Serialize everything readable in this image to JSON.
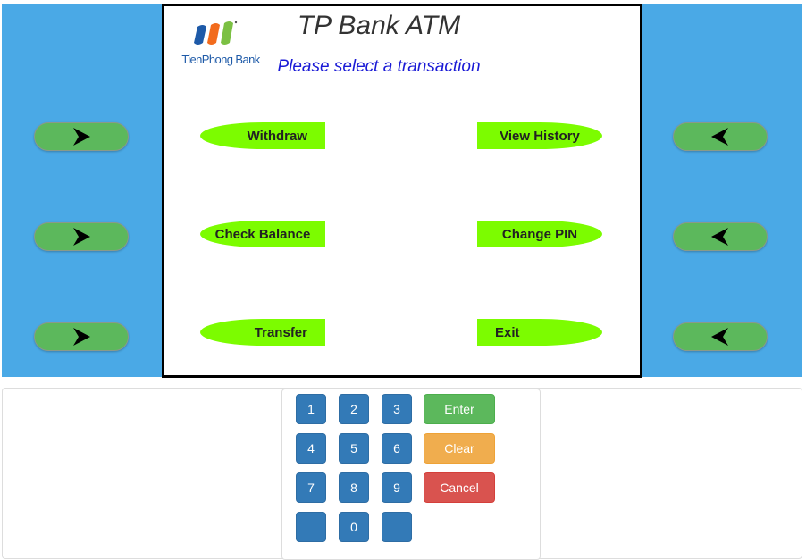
{
  "screen": {
    "title": "TP Bank ATM",
    "prompt": "Please select a transaction",
    "logo_text": "TienPhong Bank",
    "logo_colors": {
      "blue": "#1e5aa8",
      "orange": "#f26b1d",
      "green": "#7bc043"
    }
  },
  "options": {
    "left": [
      "Withdraw",
      "Check Balance",
      "Transfer"
    ],
    "right": [
      "View History",
      "Change PIN",
      "Exit"
    ]
  },
  "side_buttons": {
    "left_icon": "arrow-right-icon",
    "right_icon": "arrow-left-icon"
  },
  "keypad": {
    "keys": [
      "1",
      "2",
      "3",
      "4",
      "5",
      "6",
      "7",
      "8",
      "9",
      "",
      "0",
      ""
    ],
    "enter_label": "Enter",
    "clear_label": "Clear",
    "cancel_label": "Cancel"
  },
  "colors": {
    "side_panel": "#4aa9e6",
    "option_green": "#7cfc00",
    "side_button_green": "#5cb85c",
    "key_blue": "#337ab7",
    "enter": "#5cb85c",
    "clear": "#f0ad4e",
    "cancel": "#d9534f",
    "prompt": "#1a1ad6"
  }
}
